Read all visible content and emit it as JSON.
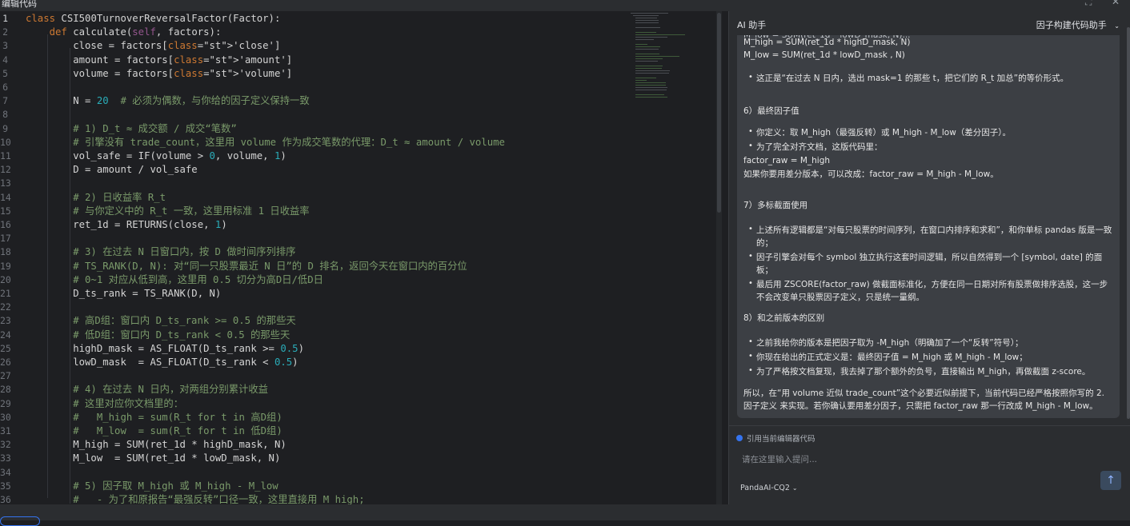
{
  "window": {
    "title": "编辑代码"
  },
  "editor": {
    "lines": [
      {
        "n": "1",
        "text": "class CSI500TurnoverReversalFactor(Factor):"
      },
      {
        "n": "2",
        "text": "    def calculate(self, factors):"
      },
      {
        "n": "3",
        "text": "        close = factors['close']"
      },
      {
        "n": "4",
        "text": "        amount = factors['amount']"
      },
      {
        "n": "5",
        "text": "        volume = factors['volume']"
      },
      {
        "n": "6",
        "text": ""
      },
      {
        "n": "7",
        "text": "        N = 20  # 必须为偶数，与你给的因子定义保持一致"
      },
      {
        "n": "8",
        "text": ""
      },
      {
        "n": "9",
        "text": "        # 1) D_t ≈ 成交额 / 成交“笔数”"
      },
      {
        "n": "10",
        "text": "        # 引擎没有 trade_count，这里用 volume 作为成交笔数的代理：D_t ≈ amount / volume"
      },
      {
        "n": "11",
        "text": "        vol_safe = IF(volume > 0, volume, 1)"
      },
      {
        "n": "12",
        "text": "        D = amount / vol_safe"
      },
      {
        "n": "13",
        "text": ""
      },
      {
        "n": "14",
        "text": "        # 2) 日收益率 R_t"
      },
      {
        "n": "15",
        "text": "        # 与你定义中的 R_t 一致，这里用标准 1 日收益率"
      },
      {
        "n": "16",
        "text": "        ret_1d = RETURNS(close, 1)"
      },
      {
        "n": "17",
        "text": ""
      },
      {
        "n": "18",
        "text": "        # 3) 在过去 N 日窗口内，按 D 做时间序列排序"
      },
      {
        "n": "19",
        "text": "        # TS_RANK(D, N): 对“同一只股票最近 N 日”的 D 排名，返回今天在窗口内的百分位"
      },
      {
        "n": "20",
        "text": "        # 0~1 对应从低到高，这里用 0.5 切分为高D日/低D日"
      },
      {
        "n": "21",
        "text": "        D_ts_rank = TS_RANK(D, N)"
      },
      {
        "n": "22",
        "text": ""
      },
      {
        "n": "23",
        "text": "        # 高D组：窗口内 D_ts_rank >= 0.5 的那些天"
      },
      {
        "n": "24",
        "text": "        # 低D组：窗口内 D_ts_rank < 0.5 的那些天"
      },
      {
        "n": "25",
        "text": "        highD_mask = AS_FLOAT(D_ts_rank >= 0.5)"
      },
      {
        "n": "26",
        "text": "        lowD_mask  = AS_FLOAT(D_ts_rank < 0.5)"
      },
      {
        "n": "27",
        "text": ""
      },
      {
        "n": "28",
        "text": "        # 4) 在过去 N 日内，对两组分别累计收益"
      },
      {
        "n": "29",
        "text": "        # 这里对应你文档里的："
      },
      {
        "n": "30",
        "text": "        #   M_high = sum(R_t for t in 高D组)"
      },
      {
        "n": "31",
        "text": "        #   M_low  = sum(R_t for t in 低D组)"
      },
      {
        "n": "32",
        "text": "        M_high = SUM(ret_1d * highD_mask, N)"
      },
      {
        "n": "33",
        "text": "        M_low  = SUM(ret_1d * lowD_mask, N)"
      },
      {
        "n": "34",
        "text": ""
      },
      {
        "n": "35",
        "text": "        # 5) 因子取 M_high 或 M_high - M_low"
      },
      {
        "n": "36",
        "text": "        #   - 为了和原报告“最强反转”口径一致，这里直接用 M_high;"
      }
    ]
  },
  "ai": {
    "title": "AI 助手",
    "mode": "因子构建代码助手",
    "messages": [
      "M_high = SUM(ret_1d * highD_mask, N)",
      "M_low  = SUM(ret_1d * lowD_mask , N)",
      "这正是“在过去 N 日内，选出 mask=1 的那些 t，把它们的 R_t 加总”的等价形式。",
      "6）最终因子值",
      "你定义：取 M_high（最强反转）或 M_high - M_low（差分因子）。",
      "为了完全对齐文档，这版代码里：",
      "factor_raw = M_high",
      "如果你要用差分版本，可以改成：factor_raw = M_high - M_low。",
      "7）多标截面使用",
      "上述所有逻辑都是“对每只股票的时间序列，在窗口内排序和求和”，和你单标 pandas 版是一致的；",
      "因子引擎会对每个 symbol 独立执行这套时间逻辑，所以自然得到一个 [symbol, date] 的面板；",
      "最后用 ZSCORE(factor_raw) 做截面标准化，方便在同一日期对所有股票做排序选股，这一步不会改变单只股票因子定义，只是统一量纲。",
      "8）和之前版本的区别",
      "之前我给你的版本是把因子取为 -M_high（明确加了一个“反转”符号）；",
      "你现在给出的正式定义是：最终因子值 = M_high 或 M_high - M_low；",
      "为了严格按文档复现，我去掉了那个额外的负号，直接输出 M_high，再做截面 z-score。",
      "所以，在“用 volume 近似 trade_count”这个必要近似前提下，当前代码已经严格按照你写的 2. 因子定义 来实现。若你确认要用差分因子，只需把 factor_raw 那一行改成 M_high - M_low。"
    ],
    "ref_label": "引用当前编辑器代码",
    "input_placeholder": "请在这里输入提问...",
    "model": "PandaAI-CQ2",
    "send_icon": "↑"
  }
}
